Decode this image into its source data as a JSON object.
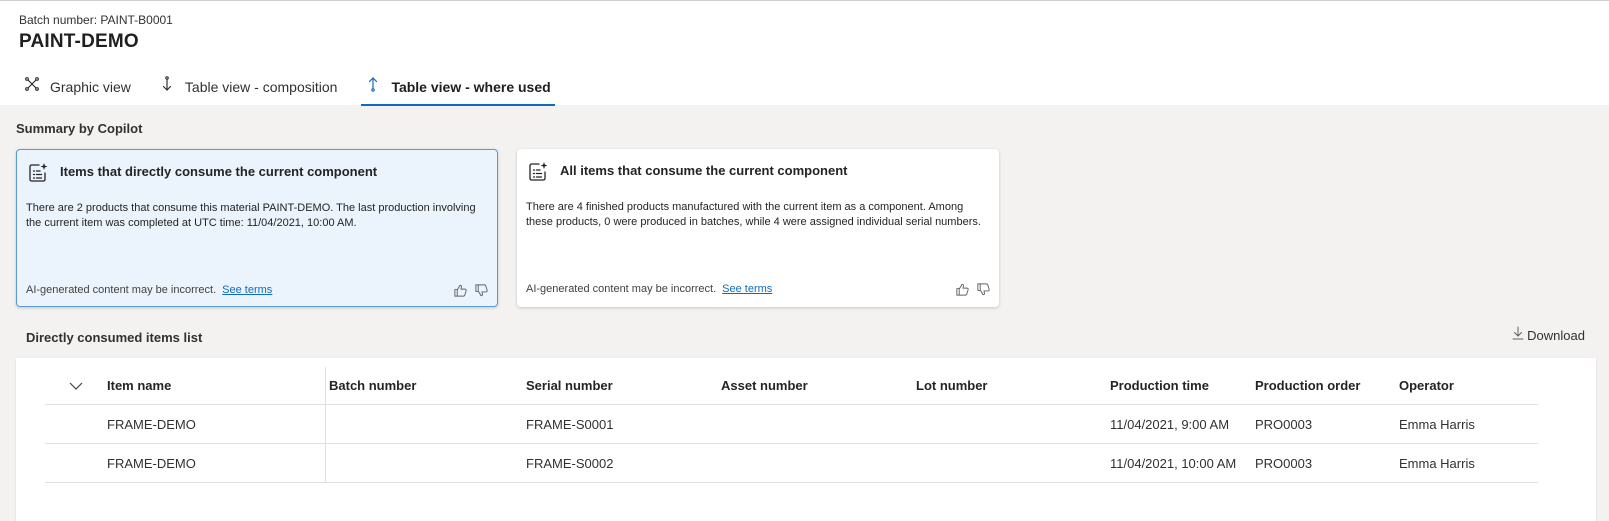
{
  "header": {
    "batch_label": "Batch number: PAINT-B0001",
    "title": "PAINT-DEMO"
  },
  "tabs": [
    {
      "label": "Graphic view",
      "icon": "graphic-view-icon",
      "active": false
    },
    {
      "label": "Table view - composition",
      "icon": "arrow-down-icon",
      "active": false
    },
    {
      "label": "Table view - where used",
      "icon": "arrow-up-icon",
      "active": true
    }
  ],
  "copilot": {
    "heading": "Summary by Copilot",
    "cards": [
      {
        "title": "Items that directly consume the current component",
        "text": "There are 2 products that consume this material PAINT-DEMO. The last production involving the current item was completed at UTC time: 11/04/2021, 10:00 AM.",
        "disclaimer": "AI-generated content may be incorrect.",
        "link": "See terms",
        "selected": true
      },
      {
        "title": "All items that consume the current component",
        "text": "There are 4 finished products manufactured with the current item as a component. Among these products, 0 were produced in batches, while 4 were assigned individual serial numbers.",
        "disclaimer": "AI-generated content may be incorrect.",
        "link": "See terms",
        "selected": false
      }
    ]
  },
  "list": {
    "heading": "Directly consumed items list",
    "download_label": "Download",
    "columns": [
      "Item name",
      "Batch number",
      "Serial number",
      "Asset number",
      "Lot number",
      "Production time",
      "Production order",
      "Operator"
    ],
    "rows": [
      {
        "item": "FRAME-DEMO",
        "batch": "",
        "serial": "FRAME-S0001",
        "asset": "",
        "lot": "",
        "time": "11/04/2021, 9:00 AM",
        "order": "PRO0003",
        "operator": "Emma Harris"
      },
      {
        "item": "FRAME-DEMO",
        "batch": "",
        "serial": "FRAME-S0002",
        "asset": "",
        "lot": "",
        "time": "11/04/2021, 10:00 AM",
        "order": "PRO0003",
        "operator": "Emma Harris"
      }
    ]
  },
  "colors": {
    "accent": "#0f6cbd",
    "selected_card_bg": "#ebf3fc",
    "page_bg": "#f3f2f1"
  }
}
